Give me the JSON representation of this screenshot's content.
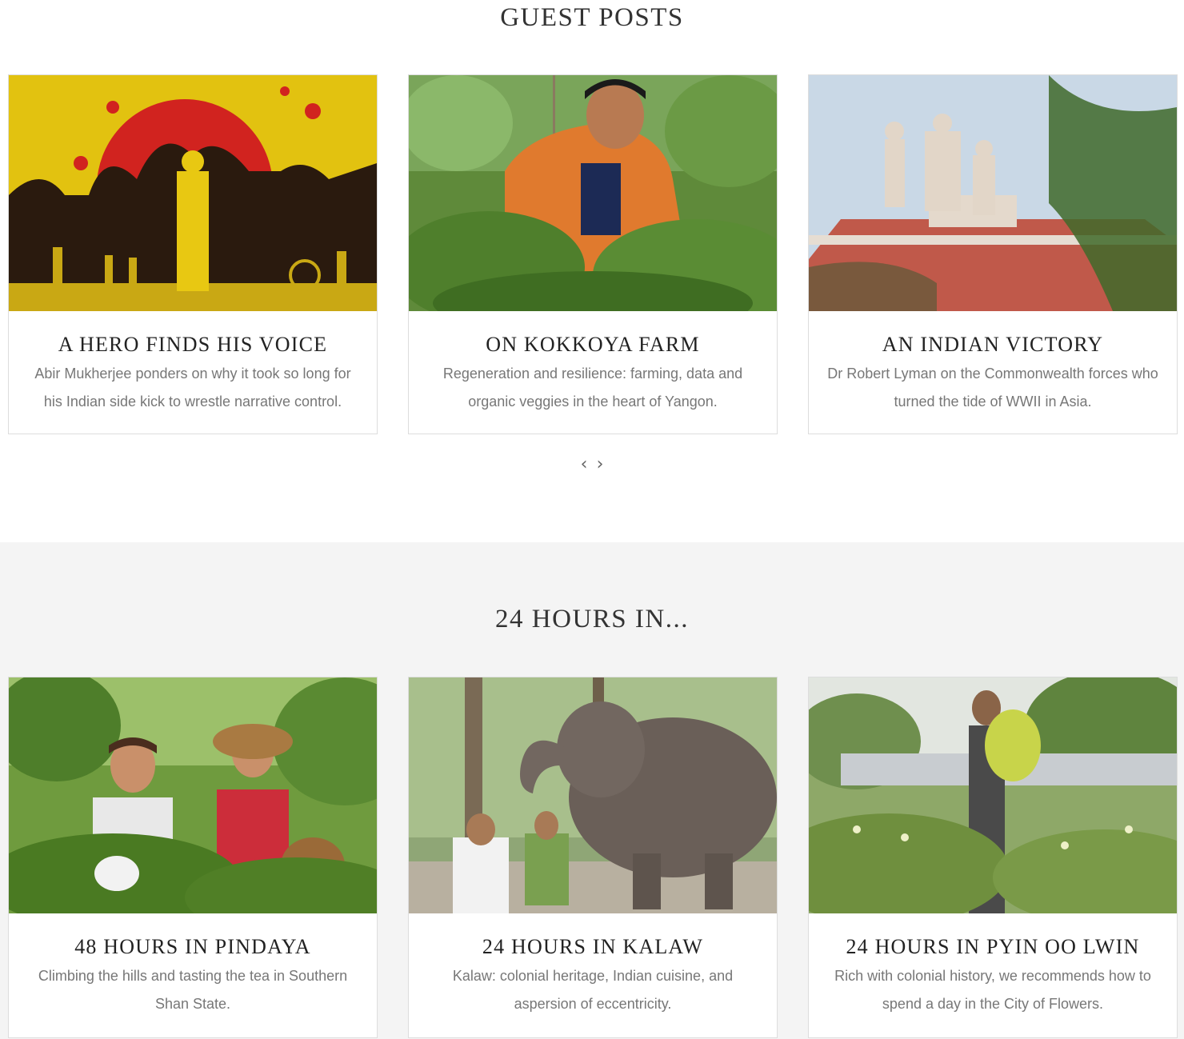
{
  "guest_posts": {
    "title": "GUEST POSTS",
    "cards": [
      {
        "title": "A HERO FINDS HIS VOICE",
        "description": "Abir Mukherjee ponders on why it took so long for his Indian side  kick to wrestle narrative control.",
        "image": "illustrated-silhouette-hero-red-sun"
      },
      {
        "title": "ON KOKKOYA FARM",
        "description": "Regeneration and resilience: farming, data and organic veggies in the heart of Yangon.",
        "image": "farmer-in-orange-shirt-among-plants"
      },
      {
        "title": "AN INDIAN VICTORY",
        "description": "Dr Robert Lyman on the Commonwealth forces who turned the tide of WWII in Asia.",
        "image": "colonial-building-statues-rooftop"
      }
    ],
    "nav": {
      "prev": "‹",
      "next": "›"
    }
  },
  "hours_in": {
    "title": "24 HOURS IN...",
    "cards": [
      {
        "title": "48 HOURS IN PINDAYA",
        "description": "Climbing the hills and tasting the tea in Southern Shan State.",
        "image": "tea-pickers-smiling-green-field"
      },
      {
        "title": "24 HOURS IN KALAW",
        "description": "Kalaw: colonial heritage, Indian cuisine, and aspersion of eccentricity.",
        "image": "elephant-with-two-men-forest"
      },
      {
        "title": "24 HOURS IN PYIN OO LWIN",
        "description": "Rich with colonial history, we recommends how to spend a day in the City of Flowers.",
        "image": "man-carrying-yellow-flowers-garden"
      }
    ]
  },
  "colors": {
    "background": "#ffffff",
    "alt_background": "#f4f4f4",
    "card_border": "#dddddd",
    "title_text": "#222222",
    "body_text": "#777777"
  }
}
